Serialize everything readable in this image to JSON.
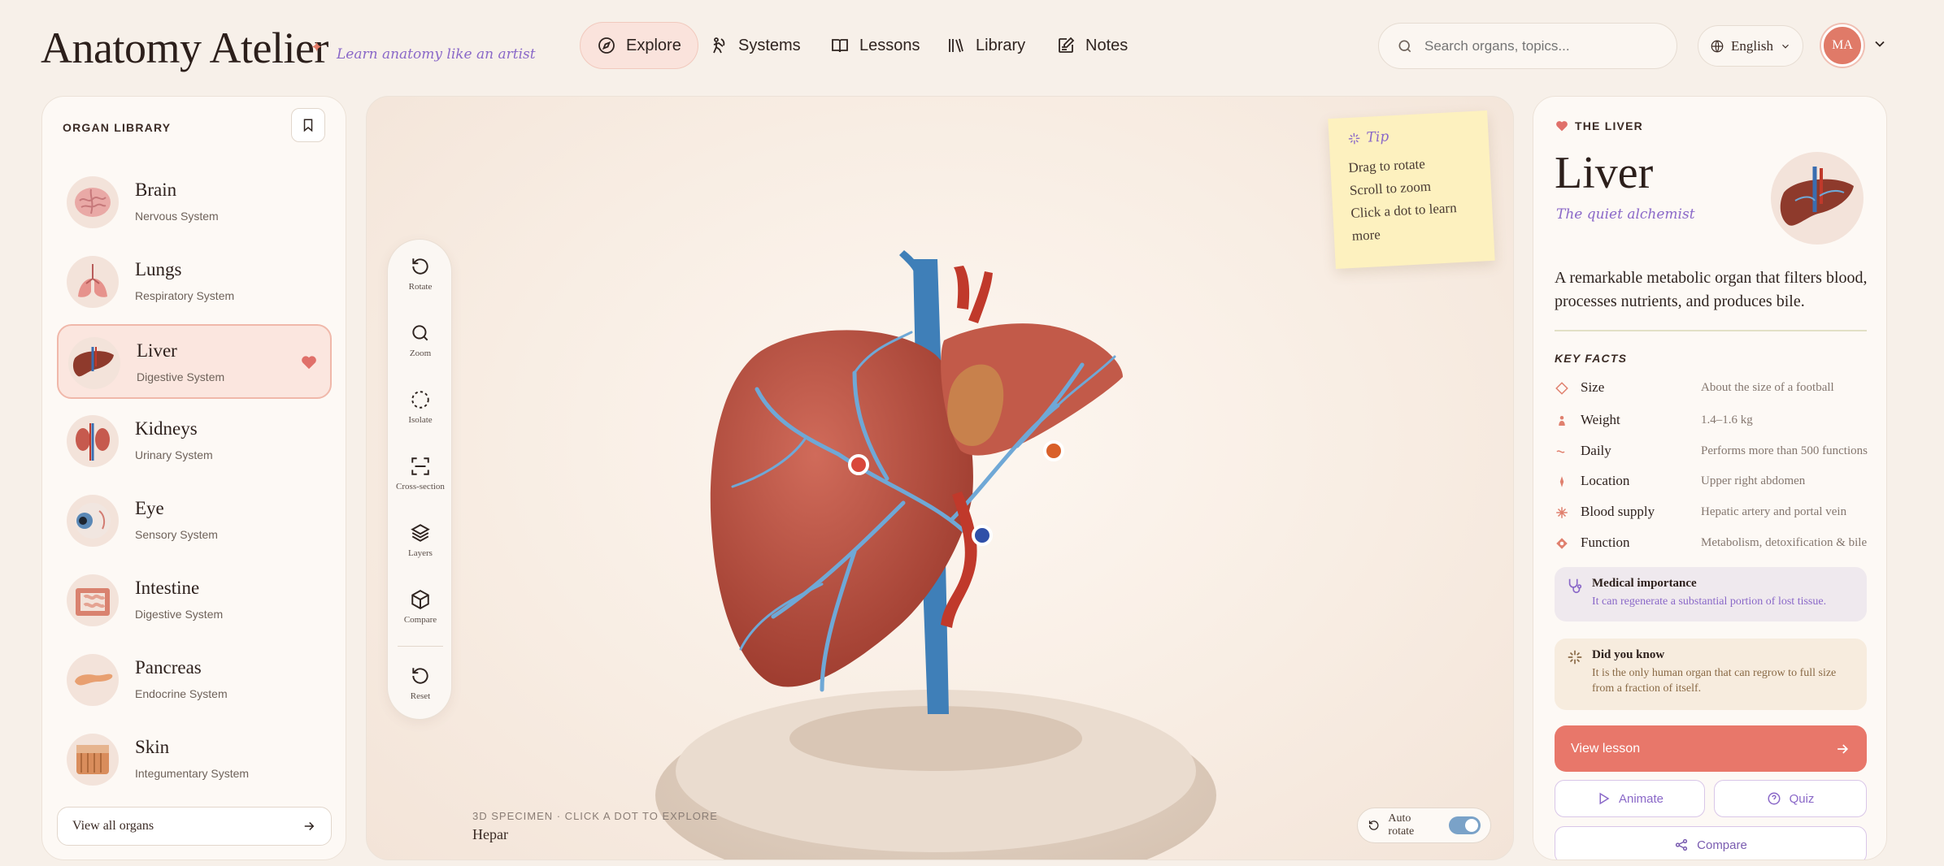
{
  "header": {
    "logo": "Anatomy Atelier",
    "tagline": "Learn anatomy like an artist",
    "nav": [
      {
        "label": "Explore",
        "icon": "compass-icon"
      },
      {
        "label": "Systems",
        "icon": "body-icon"
      },
      {
        "label": "Lessons",
        "icon": "book-icon"
      },
      {
        "label": "Library",
        "icon": "library-icon"
      },
      {
        "label": "Notes",
        "icon": "note-edit-icon"
      }
    ],
    "search_placeholder": "Search organs, topics...",
    "language": "English",
    "avatar_initials": "MA"
  },
  "library": {
    "title": "ORGAN LIBRARY",
    "organs": [
      {
        "name": "Brain",
        "system": "Nervous System"
      },
      {
        "name": "Lungs",
        "system": "Respiratory System"
      },
      {
        "name": "Liver",
        "system": "Digestive System",
        "selected": true,
        "favorite": true
      },
      {
        "name": "Kidneys",
        "system": "Urinary System"
      },
      {
        "name": "Eye",
        "system": "Sensory System"
      },
      {
        "name": "Intestine",
        "system": "Digestive System"
      },
      {
        "name": "Pancreas",
        "system": "Endocrine System"
      },
      {
        "name": "Skin",
        "system": "Integumentary System"
      }
    ],
    "view_all": "View all organs"
  },
  "viewer": {
    "tools": [
      "Rotate",
      "Zoom",
      "Isolate",
      "Cross-section",
      "Layers",
      "Compare",
      "Reset"
    ],
    "tip": {
      "title": "Tip",
      "lines": [
        "Drag to rotate",
        "Scroll to zoom",
        "Click a dot to learn",
        "more"
      ]
    },
    "caption": "3D SPECIMEN · CLICK A DOT TO EXPLORE",
    "specimen_name": "Hepar",
    "auto_rotate_label": "Auto rotate",
    "auto_rotate_on": true,
    "hotspot_colors": [
      "#d9473a",
      "#d9602a",
      "#2f4fa8"
    ]
  },
  "detail": {
    "eyebrow": "THE LIVER",
    "title": "Liver",
    "subtitle": "The quiet alchemist",
    "description": "A remarkable metabolic organ that filters blood, processes nutrients, and produces bile.",
    "facts_title": "KEY FACTS",
    "facts": [
      {
        "key": "Size",
        "value": "About the size of a football",
        "icon": "diamond-outline-icon"
      },
      {
        "key": "Weight",
        "value": "1.4–1.6 kg",
        "icon": "person-icon"
      },
      {
        "key": "Daily",
        "value": "Performs more than 500 functions",
        "icon": "wave-icon"
      },
      {
        "key": "Location",
        "value": "Upper right abdomen",
        "icon": "pin-icon"
      },
      {
        "key": "Blood supply",
        "value": "Hepatic artery and portal vein",
        "icon": "blood-drop-icon"
      },
      {
        "key": "Function",
        "value": "Metabolism, detoxification & bile",
        "icon": "diamond-icon"
      }
    ],
    "medical": {
      "title": "Medical importance",
      "body": "It can regenerate a substantial portion of lost tissue."
    },
    "did_you_know": {
      "title": "Did you know",
      "body": "It is the only human organ that can regrow to full size from a fraction of itself."
    },
    "view_lesson": "View lesson",
    "animate": "Animate",
    "quiz": "Quiz",
    "compare": "Compare"
  },
  "colors": {
    "accent": "#e8776a",
    "purple": "#8a68c8",
    "background": "#f7f0e9"
  }
}
